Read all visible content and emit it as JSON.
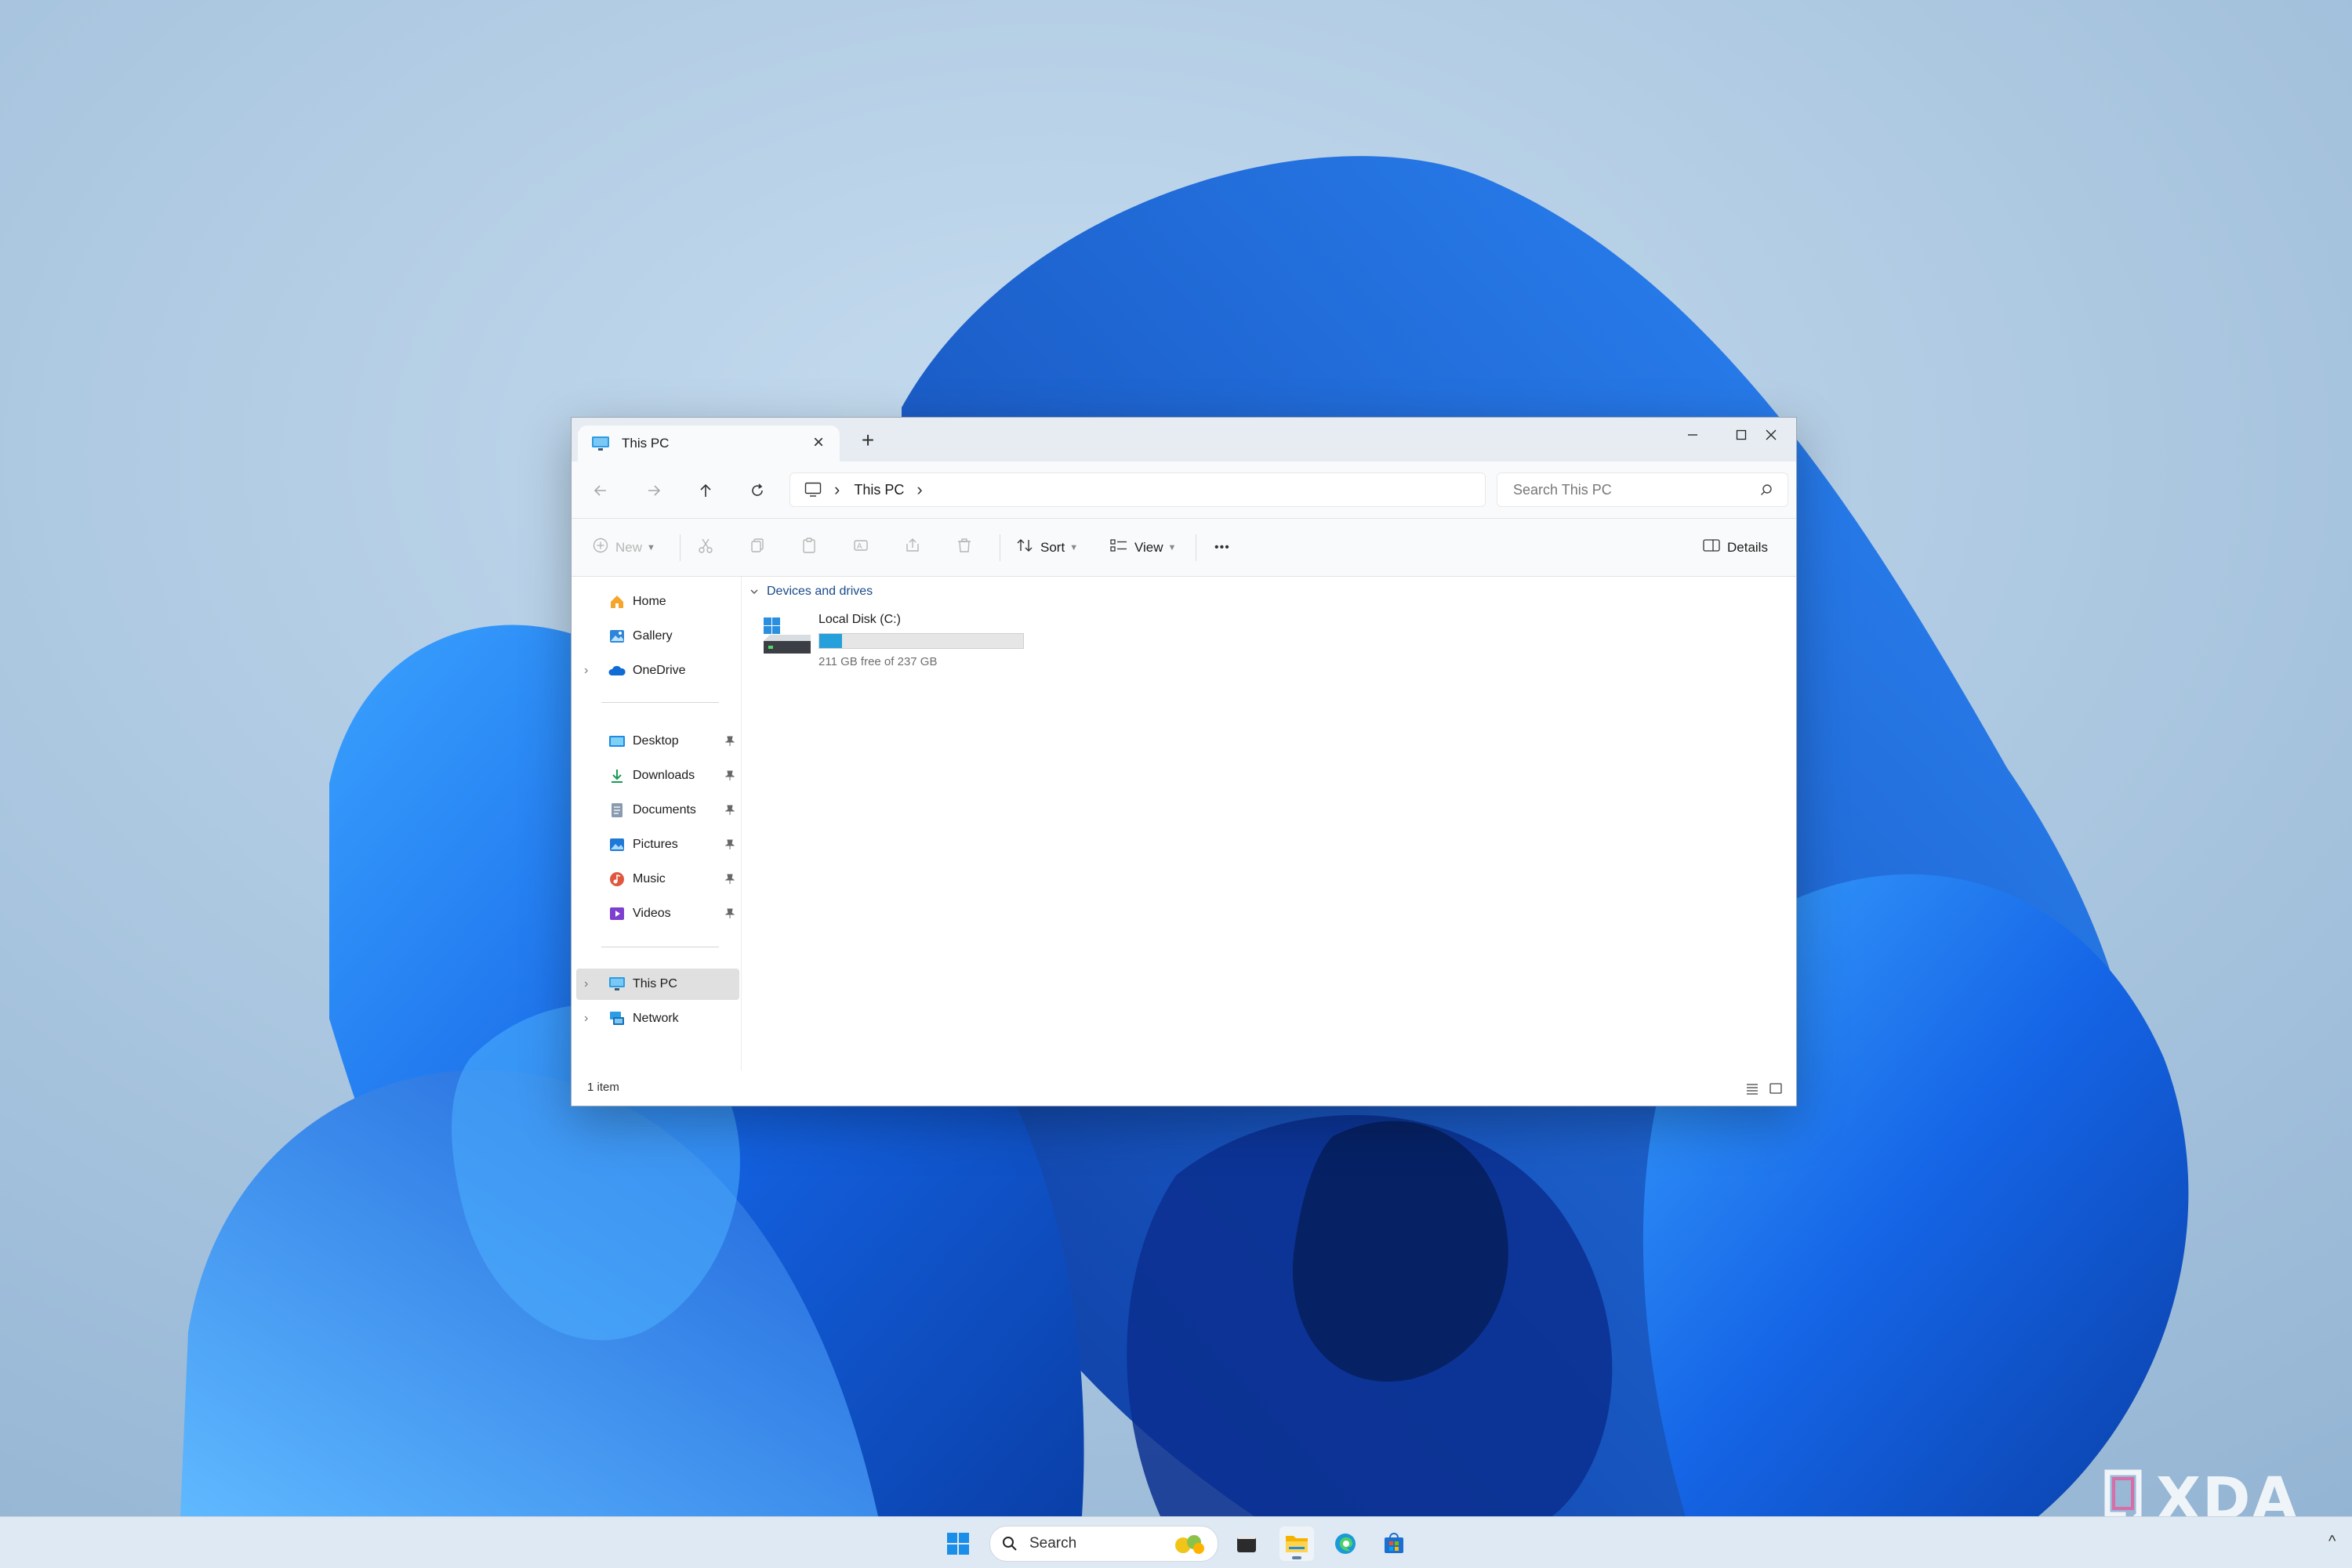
{
  "window": {
    "tab_title": "This PC",
    "new_tab_symbol": "+"
  },
  "navigation": {
    "breadcrumb": [
      "This PC"
    ],
    "search_placeholder": "Search This PC"
  },
  "toolbar": {
    "new_label": "New",
    "sort_label": "Sort",
    "view_label": "View",
    "more_symbol": "•••",
    "details_label": "Details"
  },
  "sidebar": {
    "quick": [
      {
        "label": "Home",
        "icon": "home-icon"
      },
      {
        "label": "Gallery",
        "icon": "gallery-icon"
      },
      {
        "label": "OneDrive",
        "icon": "onedrive-icon"
      }
    ],
    "pinned": [
      {
        "label": "Desktop",
        "icon": "desktop-folder-icon"
      },
      {
        "label": "Downloads",
        "icon": "downloads-icon"
      },
      {
        "label": "Documents",
        "icon": "documents-icon"
      },
      {
        "label": "Pictures",
        "icon": "pictures-icon"
      },
      {
        "label": "Music",
        "icon": "music-icon"
      },
      {
        "label": "Videos",
        "icon": "videos-icon"
      }
    ],
    "locations": [
      {
        "label": "This PC",
        "icon": "pc-icon",
        "selected": true
      },
      {
        "label": "Network",
        "icon": "network-icon"
      }
    ]
  },
  "content": {
    "group_title": "Devices and drives",
    "drive": {
      "name": "Local Disk (C:)",
      "free_text": "211 GB free of 237 GB",
      "used_fraction": 0.11
    }
  },
  "status": {
    "item_count": "1 item"
  },
  "taskbar": {
    "search_placeholder": "Search",
    "apps": [
      "start-icon",
      "file-explorer-icon",
      "edge-icon",
      "store-icon",
      "terminal-icon"
    ]
  },
  "watermark": "XDA",
  "colors": {
    "accent": "#26a0da",
    "selection": "#e0e0e0",
    "wallpaper_blue": "#1e6fe0"
  }
}
